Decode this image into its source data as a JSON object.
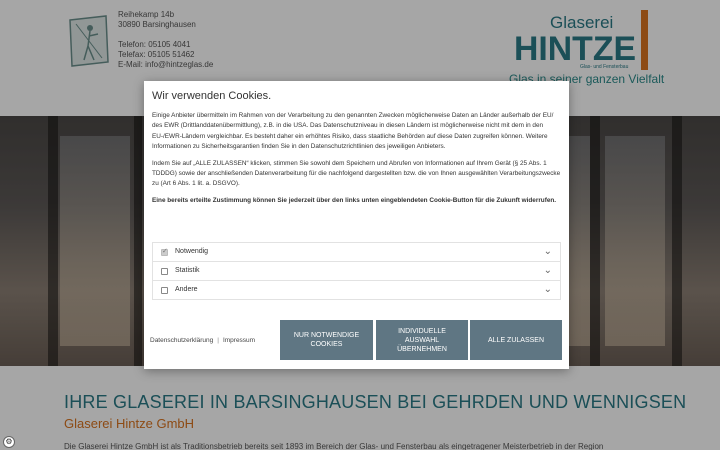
{
  "header": {
    "address": {
      "street": "Reihekamp 14b",
      "city": "30890 Barsinghausen",
      "phone": "Telefon: 05105 4041",
      "fax": "Telefax: 05105 51462",
      "email": "E-Mail: info@hintzeglas.de"
    },
    "brand": {
      "name_top": "Glaserei",
      "name_main": "HINTZE",
      "subline": "Glas- und Fensterbau",
      "tagline": "Glas in seiner ganzen Vielfalt"
    }
  },
  "content": {
    "heading": "IHRE GLASEREI IN BARSINGHAUSEN BEI GEHRDEN UND WENNIGSEN",
    "subheading": "Glaserei Hintze GmbH",
    "intro": "Die Glaserei Hintze GmbH ist als Traditionsbetrieb bereits seit 1893 im Bereich der Glas- und Fensterbau als eingetragener Meisterbetrieb in der Region"
  },
  "cookie_modal": {
    "title": "Wir verwenden Cookies.",
    "paragraph1": "Einige Anbieter übermitteln im Rahmen von der Verarbeitung zu den genannten Zwecken möglicherweise Daten an Länder außerhalb der EU/ des EWR (Drittlanddatenübermittlung), z.B. in die USA. Das Datenschutzniveau in diesen Ländern ist möglicherweise nicht mit dem in den EU-/EWR-Ländern vergleichbar. Es besteht daher ein erhöhtes Risiko, dass staatliche Behörden auf diese Daten zugreifen können. Weitere Informationen zu Sicherheitsgarantien finden Sie in den Datenschutzrichtlinien des jeweiligen Anbieters.",
    "paragraph2": "Indem Sie auf „ALLE ZULASSEN“ klicken, stimmen Sie sowohl dem Speichern und Abrufen von Informationen auf Ihrem Gerät (§ 25 Abs. 1 TDDDG) sowie der anschließenden Datenverarbeitung für die nachfolgend dargestellten bzw. die von Ihnen ausgewählten Verarbeitungszwecke zu (Art 6 Abs. 1 lit. a. DSGVO).",
    "paragraph3": "Eine bereits erteilte Zustimmung können Sie jederzeit über den links unten eingeblendeten Cookie-Button für die Zukunft widerrufen.",
    "options": [
      {
        "label": "Notwendig",
        "checked": true
      },
      {
        "label": "Statistik",
        "checked": false
      },
      {
        "label": "Andere",
        "checked": false
      }
    ],
    "links": {
      "privacy": "Datenschutzerklärung",
      "separator": "|",
      "imprint": "Impressum"
    },
    "buttons": {
      "necessary_only": "NUR NOTWENDIGE COOKIES",
      "individual": "INDIVIDUELLE AUSWAHL ÜBERNEHMEN",
      "accept_all": "ALLE ZULASSEN"
    }
  },
  "colors": {
    "teal": "#2a7a86",
    "orange": "#d9731f",
    "button": "#5f7683"
  }
}
